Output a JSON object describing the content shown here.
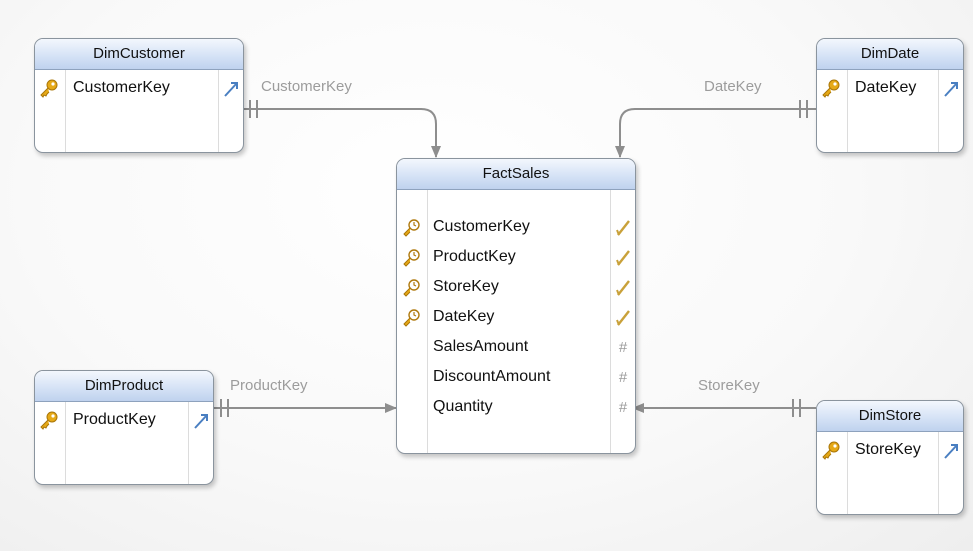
{
  "diagram": {
    "entities": {
      "dim_customer": {
        "title": "DimCustomer",
        "columns": [
          {
            "name": "CustomerKey",
            "key_icon": "primary-key-icon",
            "type_icon": "link-icon"
          }
        ]
      },
      "dim_date": {
        "title": "DimDate",
        "columns": [
          {
            "name": "DateKey",
            "key_icon": "primary-key-icon",
            "type_icon": "link-icon"
          }
        ]
      },
      "dim_product": {
        "title": "DimProduct",
        "columns": [
          {
            "name": "ProductKey",
            "key_icon": "primary-key-icon",
            "type_icon": "link-icon"
          }
        ]
      },
      "dim_store": {
        "title": "DimStore",
        "columns": [
          {
            "name": "StoreKey",
            "key_icon": "primary-key-icon",
            "type_icon": "link-icon"
          }
        ]
      },
      "fact_sales": {
        "title": "FactSales",
        "columns": [
          {
            "name": "CustomerKey",
            "key_icon": "foreign-key-icon",
            "type_icon": "check-icon"
          },
          {
            "name": "ProductKey",
            "key_icon": "foreign-key-icon",
            "type_icon": "check-icon"
          },
          {
            "name": "StoreKey",
            "key_icon": "foreign-key-icon",
            "type_icon": "check-icon"
          },
          {
            "name": "DateKey",
            "key_icon": "foreign-key-icon",
            "type_icon": "check-icon"
          },
          {
            "name": "SalesAmount",
            "key_icon": "",
            "type_icon": "numeric-icon",
            "type_glyph": "#"
          },
          {
            "name": "DiscountAmount",
            "key_icon": "",
            "type_icon": "numeric-icon",
            "type_glyph": "#"
          },
          {
            "name": "Quantity",
            "key_icon": "",
            "type_icon": "numeric-icon",
            "type_glyph": "#"
          }
        ]
      }
    },
    "relationships": [
      {
        "label": "CustomerKey",
        "from": "DimCustomer",
        "to": "FactSales"
      },
      {
        "label": "DateKey",
        "from": "DimDate",
        "to": "FactSales"
      },
      {
        "label": "ProductKey",
        "from": "DimProduct",
        "to": "FactSales"
      },
      {
        "label": "StoreKey",
        "from": "DimStore",
        "to": "FactSales"
      }
    ],
    "colors": {
      "connector": "#8e8e8e",
      "header_top": "#f3f7fd",
      "header_bottom": "#bfd2ee",
      "key_gold": "#e6a917",
      "check_gold": "#c9a13a",
      "link_blue": "#4a7fc1"
    }
  }
}
